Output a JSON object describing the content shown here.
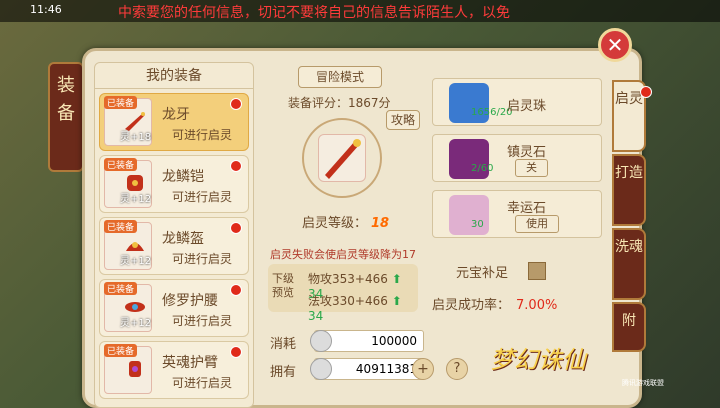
{
  "topbar": {
    "time": "11:46",
    "marquee": "中索要您的任何信息，切记不要将自己的信息告诉陌生人，以免"
  },
  "side_label": "装备",
  "left_list": {
    "header": "我的装备",
    "items": [
      {
        "tag": "已装备",
        "level": "灵+18",
        "name": "龙牙",
        "status": "可进行启灵",
        "active": true
      },
      {
        "tag": "已装备",
        "level": "灵+12",
        "name": "龙鳞铠",
        "status": "可进行启灵",
        "active": false
      },
      {
        "tag": "已装备",
        "level": "灵+12",
        "name": "龙鳞盔",
        "status": "可进行启灵",
        "active": false
      },
      {
        "tag": "已装备",
        "level": "灵+12",
        "name": "修罗护腰",
        "status": "可进行启灵",
        "active": false
      },
      {
        "tag": "已装备",
        "level": "",
        "name": "英魂护臂",
        "status": "可进行启灵",
        "active": false
      }
    ]
  },
  "center": {
    "mode_button": "冒险模式",
    "score_label": "装备评分：1867分",
    "strategy_button": "攻略",
    "qling_level_label": "启灵等级：",
    "qling_level_value": "18",
    "fail_note": "启灵失败会使启灵等级降为17",
    "preview": {
      "label": "下级预览",
      "row1": "物攻353+466",
      "row1_delta": "34",
      "row2": "法攻330+466",
      "row2_delta": "34"
    },
    "cost_label": "消耗",
    "cost_value": "100000",
    "own_label": "拥有",
    "own_value": "40911381",
    "plus": "+",
    "help": "?"
  },
  "right": {
    "stones": [
      {
        "name": "启灵珠",
        "count": "1656/20",
        "button": ""
      },
      {
        "name": "镇灵石",
        "count": "2/60",
        "button": "关"
      },
      {
        "name": "幸运石",
        "count": "30",
        "button": "使用"
      }
    ],
    "gold_fill_label": "元宝补足",
    "rate_label": "启灵成功率：",
    "rate_value": "7.00%"
  },
  "tabs": [
    "启灵",
    "打造",
    "洗魂",
    "附"
  ],
  "logo": {
    "title": "梦幻诛仙",
    "sub": "腾讯游戏联盟"
  },
  "colors": {
    "accent": "#e02a1a",
    "panel": "#efe6cf",
    "dark_tab": "#6b2a1a"
  }
}
